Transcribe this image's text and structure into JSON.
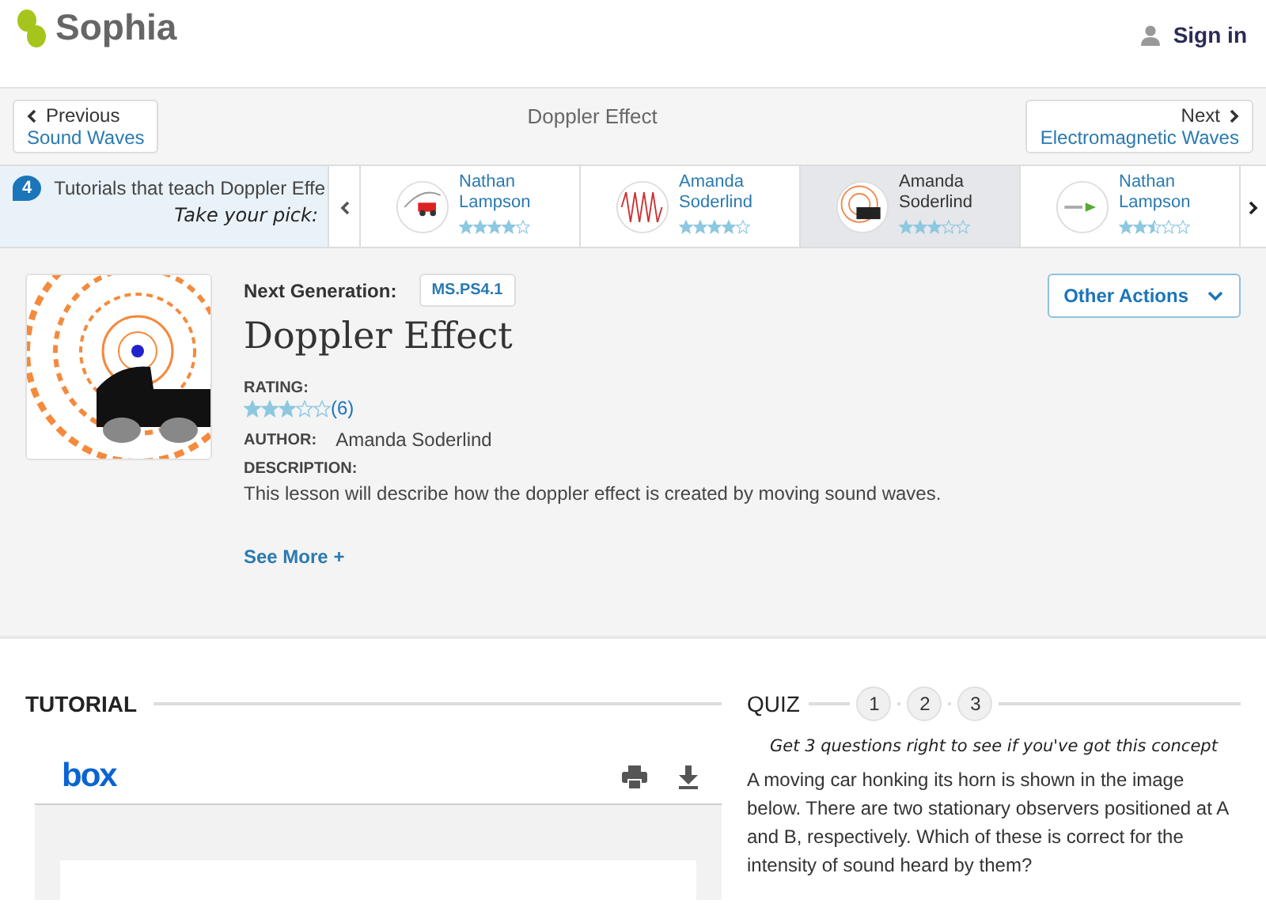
{
  "header": {
    "logo": "Sophia",
    "sign_in": "Sign in"
  },
  "nav": {
    "previous": {
      "label": "Previous",
      "target": "Sound Waves"
    },
    "title": "Doppler Effect",
    "next": {
      "label": "Next",
      "target": "Electromagnetic Waves"
    }
  },
  "carousel": {
    "count": "4",
    "heading": "Tutorials that teach Doppler Effe",
    "tagline": "Take your pick:",
    "items": [
      {
        "author_first": "Nathan",
        "author_last": "Lampson",
        "stars": 4,
        "selected": false
      },
      {
        "author_first": "Amanda",
        "author_last": "Soderlind",
        "stars": 4,
        "selected": false
      },
      {
        "author_first": "Amanda",
        "author_last": "Soderlind",
        "stars": 3,
        "selected": true
      },
      {
        "author_first": "Nathan",
        "author_last": "Lampson",
        "stars": 2.5,
        "selected": false
      }
    ]
  },
  "lesson": {
    "standard_label": "Next Generation:",
    "standard": "MS.PS4.1",
    "title": "Doppler Effect",
    "rating_label": "RATING:",
    "stars": 3,
    "rating_count": "(6)",
    "author_label": "AUTHOR:",
    "author": "Amanda Soderlind",
    "description_label": "DESCRIPTION:",
    "description": "This lesson will describe how the doppler effect is created by moving sound waves.",
    "see_more": "See More +",
    "other_actions": "Other Actions"
  },
  "tutorial": {
    "heading": "TUTORIAL",
    "viewer_logo": "box"
  },
  "quiz": {
    "heading": "QUIZ",
    "steps": [
      "1",
      "2",
      "3"
    ],
    "tagline": "Get 3 questions right to see if you've got this concept",
    "question": "A moving car honking its horn is shown in the image below. There are two stationary observers positioned at A and B, respectively. Which of these is correct for the intensity of sound heard by them?"
  }
}
